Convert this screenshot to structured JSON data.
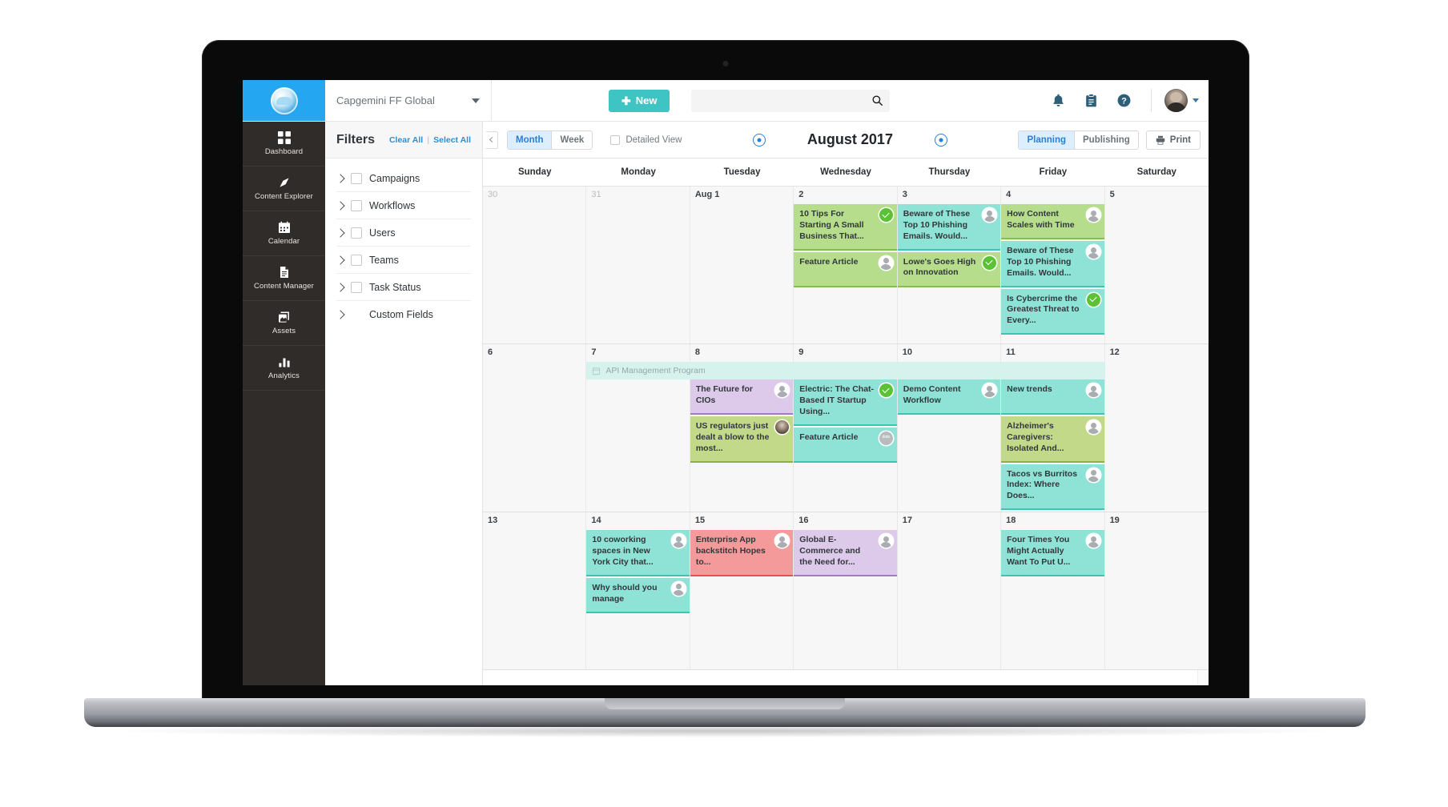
{
  "topbar": {
    "org_name": "Capgemini FF Global",
    "new_button": "New",
    "search_placeholder": "",
    "search_value": "",
    "icons": [
      "search-icon",
      "bell-icon",
      "clipboard-icon",
      "help-icon",
      "avatar"
    ]
  },
  "sidebar": {
    "items": [
      {
        "label": "Dashboard",
        "icon": "grid-icon"
      },
      {
        "label": "Content Explorer",
        "icon": "compass-icon"
      },
      {
        "label": "Calendar",
        "icon": "calendar-icon"
      },
      {
        "label": "Content Manager",
        "icon": "document-icon"
      },
      {
        "label": "Assets",
        "icon": "stack-icon"
      },
      {
        "label": "Analytics",
        "icon": "bar-chart-icon"
      }
    ]
  },
  "filters": {
    "title": "Filters",
    "clear_all": "Clear All",
    "select_all": "Select All",
    "divider": "|",
    "items": [
      {
        "label": "Campaigns",
        "checkbox": true
      },
      {
        "label": "Workflows",
        "checkbox": true
      },
      {
        "label": "Users",
        "checkbox": true
      },
      {
        "label": "Teams",
        "checkbox": true
      },
      {
        "label": "Task Status",
        "checkbox": true
      },
      {
        "label": "Custom Fields",
        "checkbox": false
      }
    ]
  },
  "calendar_toolbar": {
    "view_month": "Month",
    "view_week": "Week",
    "detailed_view": "Detailed View",
    "title": "August 2017",
    "mode_planning": "Planning",
    "mode_publishing": "Publishing",
    "print": "Print",
    "active_view": "Month",
    "active_mode": "Planning"
  },
  "calendar": {
    "weekdays": [
      "Sunday",
      "Monday",
      "Tuesday",
      "Wednesday",
      "Thursday",
      "Friday",
      "Saturday"
    ],
    "banner": {
      "label": "API Management Program",
      "icon": "calendar-small-icon"
    },
    "weeks": [
      {
        "days": [
          {
            "num": "30",
            "outside": true,
            "cards": []
          },
          {
            "num": "31",
            "outside": true,
            "cards": []
          },
          {
            "num": "Aug 1",
            "outside": false,
            "cards": []
          },
          {
            "num": "2",
            "outside": false,
            "cards": [
              {
                "title": "10 Tips For Starting A Small Business That...",
                "color": "#b5dd8c",
                "accent": "#86bf4f",
                "badge": "check"
              },
              {
                "title": "Feature Article",
                "color": "#b5dd8c",
                "accent": "#86bf4f",
                "badge": "user"
              }
            ]
          },
          {
            "num": "3",
            "outside": false,
            "cards": [
              {
                "title": "Beware of These Top 10 Phishing Emails. Would...",
                "color": "#8fe3d6",
                "accent": "#3dc5b2",
                "badge": "user"
              },
              {
                "title": "Lowe's Goes High on Innovation",
                "color": "#b5dd8c",
                "accent": "#86bf4f",
                "badge": "check"
              }
            ]
          },
          {
            "num": "4",
            "outside": false,
            "cards": [
              {
                "title": "How Content Scales with Time",
                "color": "#b5dd8c",
                "accent": "#86bf4f",
                "badge": "user"
              },
              {
                "title": "Beware of These Top 10 Phishing Emails. Would...",
                "color": "#8fe3d6",
                "accent": "#3dc5b2",
                "badge": "user"
              },
              {
                "title": "Is Cybercrime the Greatest Threat to Every...",
                "color": "#8fe3d6",
                "accent": "#3dc5b2",
                "badge": "check"
              }
            ]
          },
          {
            "num": "5",
            "outside": false,
            "cards": []
          }
        ]
      },
      {
        "has_banner": true,
        "days": [
          {
            "num": "6",
            "outside": false,
            "cards": []
          },
          {
            "num": "7",
            "outside": false,
            "cards": []
          },
          {
            "num": "8",
            "outside": false,
            "cards": [
              {
                "title": "The Future for CIOs",
                "color": "#ddc9ea",
                "accent": "#a378c4",
                "badge": "user"
              },
              {
                "title": "US regulators just dealt a blow to the most...",
                "color": "#c3d98a",
                "accent": "#8fb03f",
                "badge": "photo"
              }
            ]
          },
          {
            "num": "9",
            "outside": false,
            "cards": [
              {
                "title": "Electric: The Chat-Based IT Startup Using...",
                "color": "#8fe3d6",
                "accent": "#3dc5b2",
                "badge": "check"
              },
              {
                "title": "Feature Article",
                "color": "#8fe3d6",
                "accent": "#3dc5b2",
                "badge": "gray"
              }
            ]
          },
          {
            "num": "10",
            "outside": false,
            "cards": [
              {
                "title": "Demo Content Workflow",
                "color": "#8fe3d6",
                "accent": "#3dc5b2",
                "badge": "user"
              }
            ]
          },
          {
            "num": "11",
            "outside": false,
            "cards": [
              {
                "title": "New trends",
                "color": "#8fe3d6",
                "accent": "#3dc5b2",
                "badge": "user"
              },
              {
                "title": "Alzheimer's Caregivers: Isolated And...",
                "color": "#c3d98a",
                "accent": "#8fb03f",
                "badge": "user"
              },
              {
                "title": "Tacos vs Burritos Index: Where Does...",
                "color": "#8fe3d6",
                "accent": "#3dc5b2",
                "badge": "user"
              }
            ]
          },
          {
            "num": "12",
            "outside": false,
            "cards": []
          }
        ]
      },
      {
        "days": [
          {
            "num": "13",
            "outside": false,
            "cards": []
          },
          {
            "num": "14",
            "outside": false,
            "cards": [
              {
                "title": "10 coworking spaces in New York City that...",
                "color": "#8fe3d6",
                "accent": "#3dc5b2",
                "badge": "user"
              },
              {
                "title": "Why should you manage",
                "color": "#8fe3d6",
                "accent": "#3dc5b2",
                "badge": "user"
              }
            ]
          },
          {
            "num": "15",
            "outside": false,
            "cards": [
              {
                "title": "Enterprise App backstitch Hopes to...",
                "color": "#f59a9a",
                "accent": "#e8504f",
                "badge": "user"
              }
            ]
          },
          {
            "num": "16",
            "outside": false,
            "cards": [
              {
                "title": "Global E-Commerce and the Need for...",
                "color": "#ddc9ea",
                "accent": "#a378c4",
                "badge": "user"
              }
            ]
          },
          {
            "num": "17",
            "outside": false,
            "cards": []
          },
          {
            "num": "18",
            "outside": false,
            "cards": [
              {
                "title": "Four Times You Might Actually Want To Put U...",
                "color": "#8fe3d6",
                "accent": "#3dc5b2",
                "badge": "user"
              }
            ]
          },
          {
            "num": "19",
            "outside": false,
            "cards": []
          }
        ]
      }
    ]
  },
  "colors": {
    "brand_blue": "#24a6f0",
    "new_button": "#3fc4c4",
    "accent_link": "#2a8fd4",
    "sidebar_bg": "#2f2c29"
  }
}
